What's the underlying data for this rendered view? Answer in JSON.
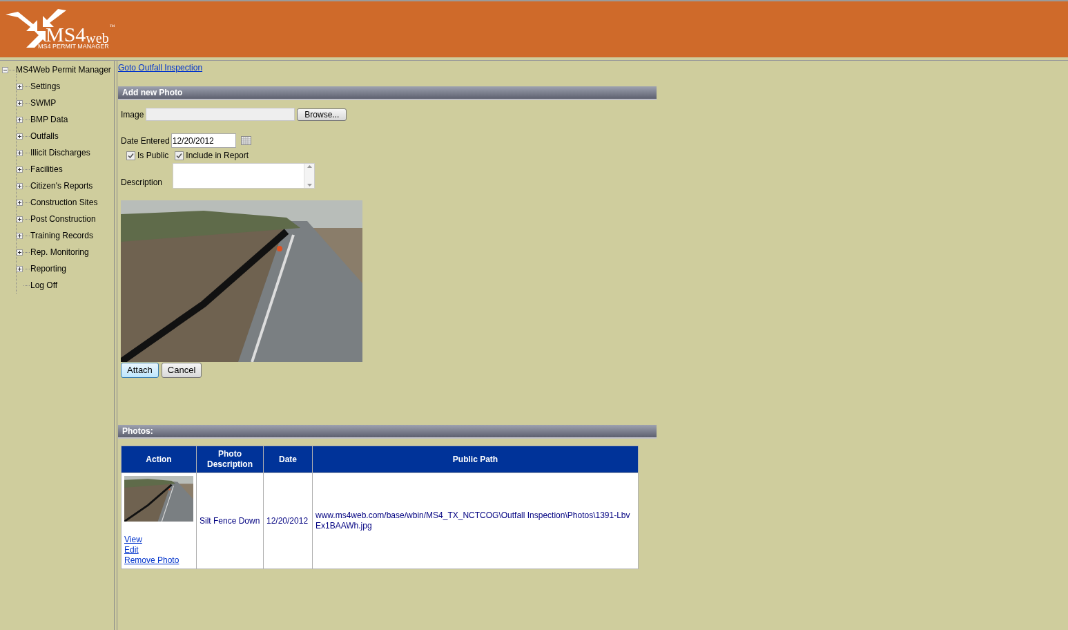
{
  "header": {
    "logo_main": "MS4",
    "logo_suffix": "web",
    "logo_tm": "™",
    "logo_subtitle": "MS4 PERMIT MANAGER"
  },
  "tree": {
    "label": "MS4Web Permit Manager",
    "expanded": true,
    "children": [
      {
        "label": "Settings",
        "expandable": true
      },
      {
        "label": "SWMP",
        "expandable": true
      },
      {
        "label": "BMP Data",
        "expandable": true
      },
      {
        "label": "Outfalls",
        "expandable": true
      },
      {
        "label": "Illicit Discharges",
        "expandable": true
      },
      {
        "label": "Facilities",
        "expandable": true
      },
      {
        "label": "Citizen's Reports",
        "expandable": true
      },
      {
        "label": "Construction Sites",
        "expandable": true
      },
      {
        "label": "Post Construction",
        "expandable": true
      },
      {
        "label": "Training Records",
        "expandable": true
      },
      {
        "label": "Rep. Monitoring",
        "expandable": true
      },
      {
        "label": "Reporting",
        "expandable": true
      },
      {
        "label": "Log Off",
        "expandable": false
      }
    ]
  },
  "goto_link": "Goto Outfall Inspection",
  "add_photo": {
    "title": "Add new Photo",
    "image_label": "Image",
    "browse_button": "Browse...",
    "date_label": "Date Entered",
    "date_value": "12/20/2012",
    "is_public": {
      "label": "Is Public",
      "checked": true
    },
    "include_in_report": {
      "label": "Include in Report",
      "checked": true
    },
    "description_label": "Description",
    "attach_button": "Attach",
    "cancel_button": "Cancel"
  },
  "photos": {
    "title": "Photos:",
    "columns": [
      "Action",
      "Photo Description",
      "Date",
      "Public Path"
    ],
    "rows": [
      {
        "links": [
          "View",
          "Edit",
          "Remove Photo"
        ],
        "description": "Silt Fence Down",
        "date": "12/20/2012",
        "path": "www.ms4web.com/base/wbin/MS4_TX_NCTCOG\\Outfall Inspection\\Photos\\1391-LbvEx1BAAWh.jpg"
      }
    ]
  }
}
